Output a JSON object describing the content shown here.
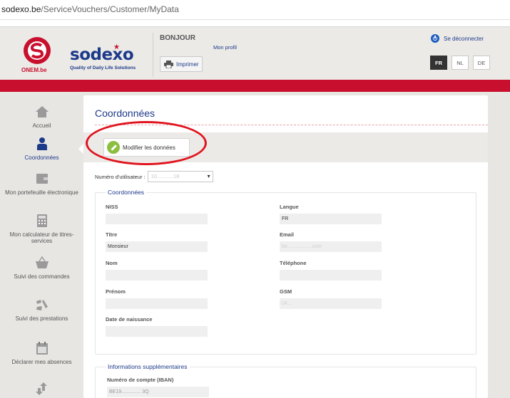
{
  "browser": {
    "url_domain": "sodexo.be",
    "url_path": "/ServiceVouchers/Customer/MyData"
  },
  "header": {
    "onem_label": "ONEM.be",
    "sodexo_label": "sodexo",
    "tagline": "Quality of Daily Life Solutions",
    "greeting": "BONJOUR",
    "profile_link": "Mon profil",
    "print_label": "Imprimer",
    "logout_label": "Se déconnecter",
    "languages": [
      "FR",
      "NL",
      "DE"
    ],
    "active_language": "FR",
    "brand_red": "#c8102e",
    "brand_blue": "#1d3a8a"
  },
  "sidebar": {
    "items": [
      {
        "label": "Accueil",
        "icon": "home-icon"
      },
      {
        "label": "Coordonnées",
        "icon": "user-icon",
        "active": true
      },
      {
        "label": "Mon portefeuille électronique",
        "icon": "wallet-icon"
      },
      {
        "label": "Mon calculateur de titres-services",
        "icon": "calculator-icon"
      },
      {
        "label": "Suivi des commandes",
        "icon": "basket-icon"
      },
      {
        "label": "Suivi des prestations",
        "icon": "cleaning-tools-icon"
      },
      {
        "label": "Déclarer mes absences",
        "icon": "calendar-icon"
      },
      {
        "label": "",
        "icon": "transfer-arrows-icon"
      }
    ]
  },
  "main": {
    "title": "Coordonnées",
    "edit_button": "Modifier les données",
    "user_number_label": "Numéro d'utilisateur :",
    "user_number_value": "10...........18",
    "section_contact": {
      "legend": "Coordonnées",
      "fields": {
        "niss": {
          "label": "NISS",
          "value": ""
        },
        "langue": {
          "label": "Langue",
          "value": "FR"
        },
        "titre": {
          "label": "Titre",
          "value": "Monsieur"
        },
        "email": {
          "label": "Email",
          "value": "be..................com"
        },
        "nom": {
          "label": "Nom",
          "value": ""
        },
        "telephone": {
          "label": "Téléphone",
          "value": ""
        },
        "prenom": {
          "label": "Prénom",
          "value": ""
        },
        "gsm": {
          "label": "GSM",
          "value": "04..."
        },
        "naissance": {
          "label": "Date de naissance",
          "value": ""
        }
      }
    },
    "section_extra": {
      "legend": "Informations supplémentaires",
      "iban_label": "Numéro de compte (IBAN)",
      "iban_value": "BE19.............. 3Q"
    }
  }
}
